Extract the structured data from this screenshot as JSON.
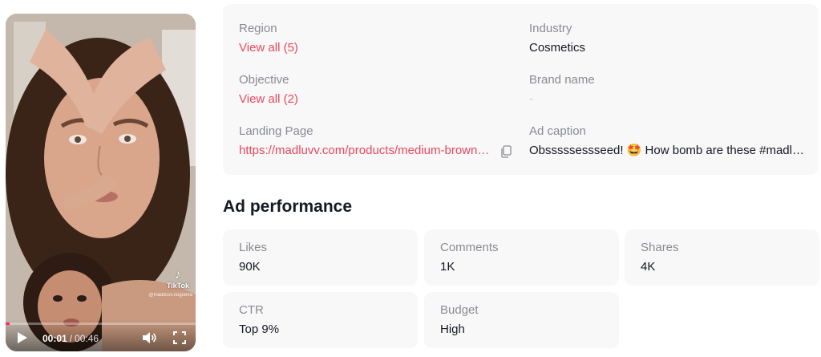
{
  "video": {
    "current_time": "00:01",
    "separator": "/",
    "duration": "00:46",
    "progress": 0.02,
    "watermark": "TikTok",
    "handle": "@madiluvv.nogueira",
    "colors": {
      "progress": "#fe2c55"
    }
  },
  "info": {
    "region": {
      "label": "Region",
      "value": "View all (5)"
    },
    "industry": {
      "label": "Industry",
      "value": "Cosmetics"
    },
    "objective": {
      "label": "Objective",
      "value": "View all (2)"
    },
    "brand": {
      "label": "Brand name",
      "value": "-"
    },
    "landing": {
      "label": "Landing Page",
      "value": "https://madluvv.com/products/medium-brown-brow-stamp-kit"
    },
    "caption": {
      "label": "Ad caption",
      "value": "Obsssssessseed! 🤩 How bomb are these #madluvv brows"
    }
  },
  "performance": {
    "title": "Ad performance",
    "stats": [
      {
        "label": "Likes",
        "value": "90K"
      },
      {
        "label": "Comments",
        "value": "1K"
      },
      {
        "label": "Shares",
        "value": "4K"
      },
      {
        "label": "CTR",
        "value": "Top 9%"
      },
      {
        "label": "Budget",
        "value": "High"
      }
    ]
  },
  "colors": {
    "link": "#e9475e",
    "card_bg": "#f8f8f8",
    "label": "#8a8b91"
  }
}
